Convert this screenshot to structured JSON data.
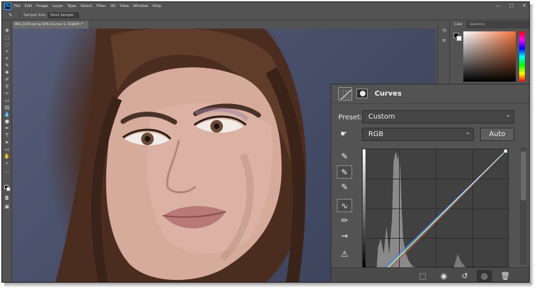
{
  "app": {
    "logo": "Ps"
  },
  "menu": [
    "File",
    "Edit",
    "Image",
    "Layer",
    "Type",
    "Select",
    "Filter",
    "3D",
    "View",
    "Window",
    "Help"
  ],
  "window_controls": {
    "minimize": "—",
    "restore": "▢",
    "close": "✕"
  },
  "options_bar": {
    "tool_icon": "eyedropper-icon",
    "sample_size_label": "Sample Size:",
    "sample_size_value": "Point Sample"
  },
  "document": {
    "tab_title": "IMG_1670.nef @ 50% (Curves 1, RGB/8*) *"
  },
  "color_panel": {
    "tabs": [
      "Color",
      "Swatches"
    ],
    "accent_color": "#f4733a"
  },
  "properties": {
    "title": "Curves",
    "preset_label": "Preset:",
    "preset_value": "Custom",
    "channel_value": "RGB",
    "auto_label": "Auto",
    "side_tools": [
      {
        "name": "black-point-eyedropper-icon",
        "glyph": "✎"
      },
      {
        "name": "gray-point-eyedropper-icon",
        "glyph": "✎"
      },
      {
        "name": "white-point-eyedropper-icon",
        "glyph": "✎"
      },
      {
        "name": "curve-point-tool-icon",
        "glyph": "∿"
      },
      {
        "name": "pencil-tool-icon",
        "glyph": "✏"
      },
      {
        "name": "smooth-curve-icon",
        "glyph": "⇝"
      },
      {
        "name": "clipping-warning-icon",
        "glyph": "⚠"
      }
    ],
    "footer": [
      {
        "name": "clip-to-layer-button",
        "glyph": "⬚"
      },
      {
        "name": "view-previous-state-button",
        "glyph": "◉"
      },
      {
        "name": "reset-button",
        "glyph": "↺"
      },
      {
        "name": "toggle-visibility-button",
        "glyph": "👁"
      },
      {
        "name": "delete-adjustment-button",
        "glyph": "🗑"
      }
    ]
  },
  "colors": {
    "panel_bg": "#535353",
    "dark_bg": "#414141",
    "red_curve": "#d94040",
    "green_curve": "#3bd36b",
    "blue_curve": "#4a78ff"
  }
}
